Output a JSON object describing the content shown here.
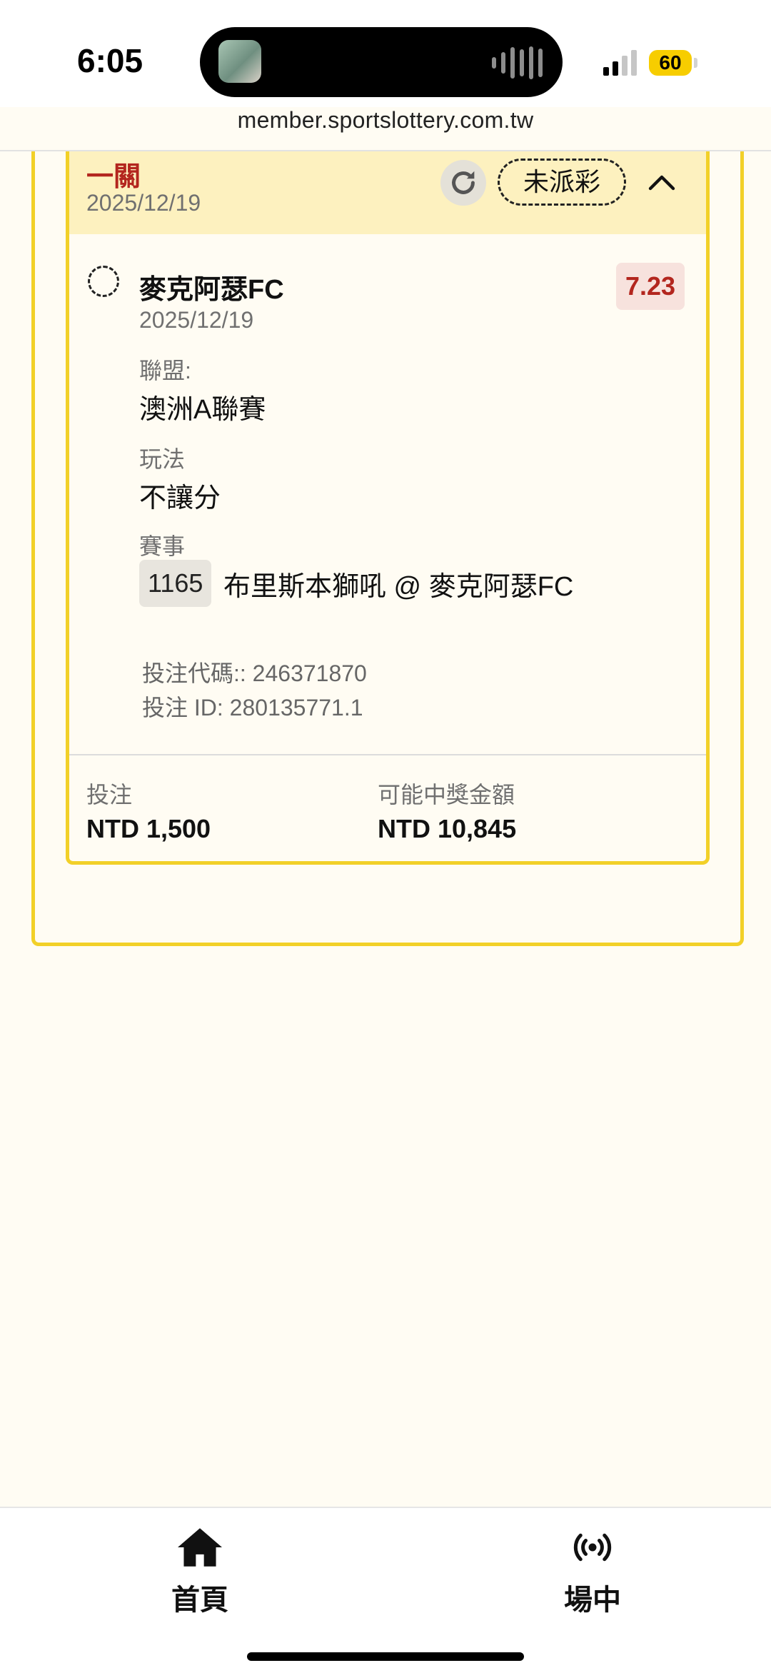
{
  "status_bar": {
    "time": "6:05",
    "battery": "60"
  },
  "browser": {
    "url": "member.sportslottery.com.tw"
  },
  "ticket": {
    "header": {
      "title": "一關",
      "date": "2025/12/19",
      "status": "未派彩"
    },
    "selection": {
      "name": "麥克阿瑟FC",
      "date": "2025/12/19",
      "odds": "7.23",
      "league_label": "聯盟:",
      "league": "澳洲A聯賽",
      "play_label": "玩法",
      "play": "不讓分",
      "match_label": "賽事",
      "match_id": "1165",
      "match": "布里斯本獅吼 @ 麥克阿瑟FC"
    },
    "bet_code": "投注代碼:: 246371870",
    "bet_id": "投注 ID: 280135771.1",
    "stake_label": "投注",
    "stake": "NTD 1,500",
    "payout_label": "可能中獎金額",
    "payout": "NTD 10,845"
  },
  "nav": [
    {
      "label": "首頁",
      "icon": "home-icon"
    },
    {
      "label": "場中",
      "icon": "live-broadcast-icon"
    }
  ],
  "colors": {
    "accent_yellow": "#f2d028",
    "header_bg": "#fdf1bf",
    "odds_red": "#b3261e",
    "page_bg": "#fffcf3"
  }
}
